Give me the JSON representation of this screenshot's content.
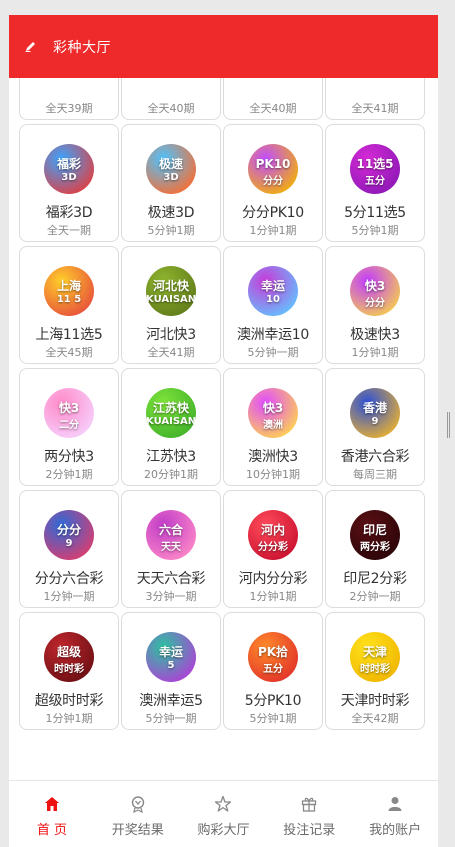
{
  "header": {
    "title": "彩种大厅",
    "icon": "pencil-icon"
  },
  "colors": {
    "brand": "#ee2a2b",
    "active_tab": "#ee1111"
  },
  "lotteries": [
    {
      "name": "",
      "period": "全天39期",
      "logo_main": "",
      "logo_sub": "",
      "c1": "#3d8de0",
      "c2": "#1b4aa0",
      "partial": true
    },
    {
      "name": "",
      "period": "全天40期",
      "logo_main": "",
      "logo_sub": "",
      "c1": "#f7a62a",
      "c2": "#e0452a",
      "partial": true
    },
    {
      "name": "",
      "period": "全天40期",
      "logo_main": "",
      "logo_sub": "",
      "c1": "#b63cff",
      "c2": "#5a1a9a",
      "partial": true
    },
    {
      "name": "",
      "period": "全天41期",
      "logo_main": "",
      "logo_sub": "",
      "c1": "#ff9a2a",
      "c2": "#ff4a7a",
      "partial": true
    },
    {
      "name": "福彩3D",
      "period": "全天一期",
      "logo_main": "福彩",
      "logo_sub": "3D",
      "c1": "#3aa4ff",
      "c2": "#e63b3b",
      "partial": false
    },
    {
      "name": "极速3D",
      "period": "5分钟1期",
      "logo_main": "极速",
      "logo_sub": "3D",
      "c1": "#4cc3ff",
      "c2": "#ff6a2a",
      "partial": false
    },
    {
      "name": "分分PK10",
      "period": "1分钟1期",
      "logo_main": "PK10",
      "logo_sub": "分分",
      "c1": "#c04cff",
      "c2": "#f4b400",
      "partial": false
    },
    {
      "name": "5分11选5",
      "period": "5分钟1期",
      "logo_main": "11选5",
      "logo_sub": "五分",
      "c1": "#d62bd6",
      "c2": "#8a17b5",
      "partial": false
    },
    {
      "name": "上海11选5",
      "period": "全天45期",
      "logo_main": "上海",
      "logo_sub": "11 5",
      "c1": "#ffcf2a",
      "c2": "#e64a3b",
      "partial": false
    },
    {
      "name": "河北快3",
      "period": "全天41期",
      "logo_main": "河北快",
      "logo_sub": "KUAISAN",
      "c1": "#8fb52e",
      "c2": "#5f7a1a",
      "partial": false
    },
    {
      "name": "澳洲幸运10",
      "period": "5分钟一期",
      "logo_main": "幸运",
      "logo_sub": "10",
      "c1": "#c83bd8",
      "c2": "#5ec7ff",
      "partial": false
    },
    {
      "name": "极速快3",
      "period": "1分钟1期",
      "logo_main": "快3",
      "logo_sub": "分分",
      "c1": "#c13bff",
      "c2": "#f7d24a",
      "partial": false
    },
    {
      "name": "两分快3",
      "period": "2分钟1期",
      "logo_main": "快3",
      "logo_sub": "二分",
      "c1": "#ff8ac8",
      "c2": "#f6d3ff",
      "partial": false
    },
    {
      "name": "江苏快3",
      "period": "20分钟1期",
      "logo_main": "江苏快",
      "logo_sub": "KUAISAN",
      "c1": "#7ee33a",
      "c2": "#3fb02a",
      "partial": false
    },
    {
      "name": "澳洲快3",
      "period": "10分钟1期",
      "logo_main": "快3",
      "logo_sub": "澳洲",
      "c1": "#e04bff",
      "c2": "#ffd84a",
      "partial": false
    },
    {
      "name": "香港六合彩",
      "period": "每周三期",
      "logo_main": "香港",
      "logo_sub": "9",
      "c1": "#2b4fd8",
      "c2": "#f0b52a",
      "partial": false
    },
    {
      "name": "分分六合彩",
      "period": "1分钟一期",
      "logo_main": "分分",
      "logo_sub": "9",
      "c1": "#2d6ad8",
      "c2": "#e23b6b",
      "partial": false
    },
    {
      "name": "天天六合彩",
      "period": "3分钟一期",
      "logo_main": "六合",
      "logo_sub": "天天",
      "c1": "#c03cc8",
      "c2": "#ff8ac8",
      "partial": false
    },
    {
      "name": "河内分分彩",
      "period": "1分钟1期",
      "logo_main": "河内",
      "logo_sub": "分分彩",
      "c1": "#ff4a5a",
      "c2": "#c8102e",
      "partial": false
    },
    {
      "name": "印尼2分彩",
      "period": "2分钟一期",
      "logo_main": "印尼",
      "logo_sub": "两分彩",
      "c1": "#5a0f14",
      "c2": "#2a0508",
      "partial": false
    },
    {
      "name": "超级时时彩",
      "period": "1分钟1期",
      "logo_main": "超级",
      "logo_sub": "时时彩",
      "c1": "#c0272d",
      "c2": "#6a0f13",
      "partial": false
    },
    {
      "name": "澳洲幸运5",
      "period": "5分钟一期",
      "logo_main": "幸运",
      "logo_sub": "5",
      "c1": "#2ac3a0",
      "c2": "#b43bd8",
      "partial": false
    },
    {
      "name": "5分PK10",
      "period": "5分钟1期",
      "logo_main": "PK拾",
      "logo_sub": "五分",
      "c1": "#ff8a2a",
      "c2": "#e0302a",
      "partial": false
    },
    {
      "name": "天津时时彩",
      "period": "全天42期",
      "logo_main": "天津",
      "logo_sub": "时时彩",
      "c1": "#ffe21a",
      "c2": "#f0b400",
      "partial": false
    }
  ],
  "tabs": [
    {
      "label": "首 页",
      "icon": "home-icon",
      "active": true
    },
    {
      "label": "开奖结果",
      "icon": "trophy-icon",
      "active": false
    },
    {
      "label": "购彩大厅",
      "icon": "star-icon",
      "active": false
    },
    {
      "label": "投注记录",
      "icon": "gift-icon",
      "active": false
    },
    {
      "label": "我的账户",
      "icon": "user-icon",
      "active": false
    }
  ]
}
